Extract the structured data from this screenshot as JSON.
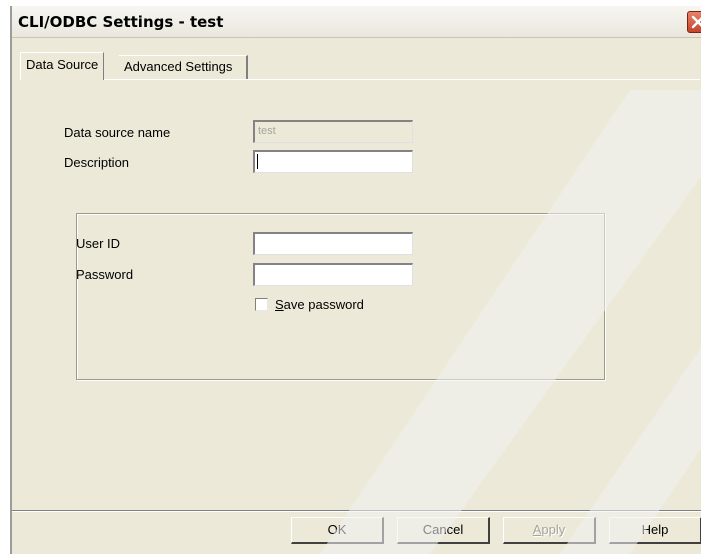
{
  "window": {
    "title": "CLI/ODBC Settings - test",
    "close_icon": "close-icon"
  },
  "tabs": [
    {
      "label": "Data Source",
      "active": true
    },
    {
      "label": "Advanced Settings",
      "active": false
    }
  ],
  "data_source": {
    "name_label": "Data source name",
    "name_value": "test",
    "description_label": "Description",
    "description_value": ""
  },
  "credentials": {
    "user_id_label": "User ID",
    "user_id_value": "",
    "password_label": "Password",
    "password_value": "",
    "save_password_label_prefix": "",
    "save_password_accel": "S",
    "save_password_label_rest": "ave password",
    "save_password_checked": false
  },
  "buttons": {
    "ok": "OK",
    "cancel": "Cancel",
    "apply_accel": "A",
    "apply_rest": "pply",
    "help": "Help"
  }
}
